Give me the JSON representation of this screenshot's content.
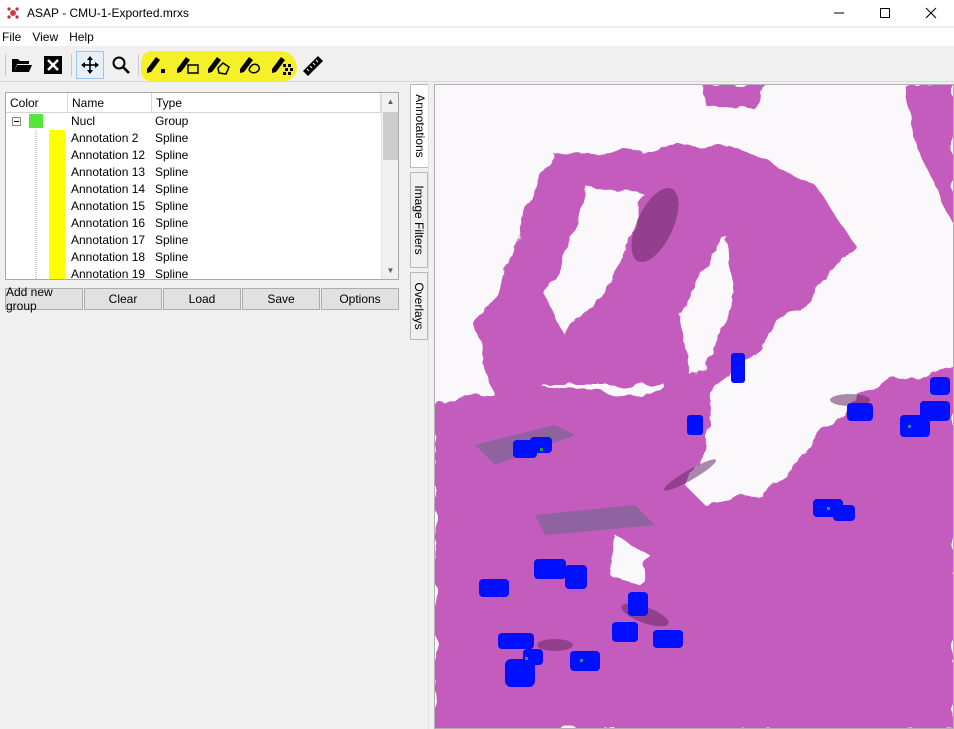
{
  "window": {
    "title": "ASAP - CMU-1-Exported.mrxs",
    "app_icon": "asap-logo-icon",
    "controls": [
      "minimize-icon",
      "maximize-icon",
      "close-icon"
    ]
  },
  "menu": [
    "File",
    "View",
    "Help"
  ],
  "toolbar": {
    "tools": [
      "open-folder-icon",
      "close-file-icon",
      "pan-icon",
      "zoom-icon",
      "dot-annotation-icon",
      "rectangle-annotation-icon",
      "polygon-annotation-icon",
      "spline-annotation-icon",
      "pointset-annotation-icon",
      "ruler-icon"
    ],
    "highlight_color": "#f5ef1a"
  },
  "annotations_panel": {
    "columns": [
      "Color",
      "Name",
      "Type"
    ],
    "group": {
      "name": "Nucl",
      "type": "Group",
      "color": "#55e53b"
    },
    "rows": [
      {
        "name": "Annotation 2",
        "type": "Spline",
        "color": "#ffff00"
      },
      {
        "name": "Annotation 12",
        "type": "Spline",
        "color": "#ffff00"
      },
      {
        "name": "Annotation 13",
        "type": "Spline",
        "color": "#ffff00"
      },
      {
        "name": "Annotation 14",
        "type": "Spline",
        "color": "#ffff00"
      },
      {
        "name": "Annotation 15",
        "type": "Spline",
        "color": "#ffff00"
      },
      {
        "name": "Annotation 16",
        "type": "Spline",
        "color": "#ffff00"
      },
      {
        "name": "Annotation 17",
        "type": "Spline",
        "color": "#ffff00"
      },
      {
        "name": "Annotation 18",
        "type": "Spline",
        "color": "#ffff00"
      },
      {
        "name": "Annotation 19",
        "type": "Spline",
        "color": "#ffff00"
      }
    ],
    "buttons": [
      "Add new group",
      "Clear",
      "Load",
      "Save",
      "Options"
    ]
  },
  "side_tabs": [
    "Annotations",
    "Image Filters",
    "Overlays"
  ],
  "viewer": {
    "tissue_color": "#c45bbd",
    "annotation_marker_color": "#0010ff"
  }
}
